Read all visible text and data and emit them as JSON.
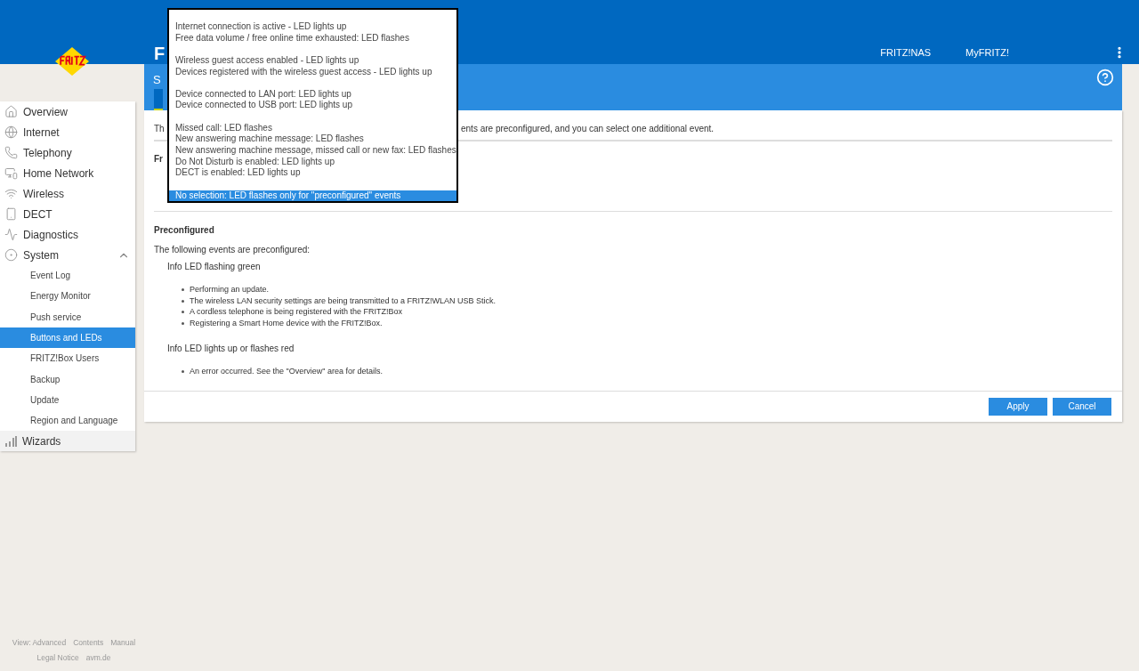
{
  "header": {
    "title_start": "F",
    "links": [
      "FRITZ!NAS",
      "MyFRITZ!"
    ]
  },
  "subheader": {
    "title_start": "S"
  },
  "sidebar": {
    "items": [
      {
        "label": "Overview",
        "selected": false
      },
      {
        "label": "Internet",
        "selected": false
      },
      {
        "label": "Telephony",
        "selected": false
      },
      {
        "label": "Home Network",
        "selected": false
      },
      {
        "label": "Wireless",
        "selected": false
      },
      {
        "label": "DECT",
        "selected": false
      },
      {
        "label": "Diagnostics",
        "selected": false
      },
      {
        "label": "System",
        "selected": false,
        "expanded": true,
        "children": [
          {
            "label": "Event Log",
            "selected": false
          },
          {
            "label": "Energy Monitor",
            "selected": false
          },
          {
            "label": "Push service",
            "selected": false
          },
          {
            "label": "Buttons and LEDs",
            "selected": true
          },
          {
            "label": "FRITZ!Box Users",
            "selected": false
          },
          {
            "label": "Backup",
            "selected": false
          },
          {
            "label": "Update",
            "selected": false
          },
          {
            "label": "Region and Language",
            "selected": false
          }
        ]
      },
      {
        "label": "Wizards",
        "selected": false
      }
    ]
  },
  "content": {
    "intro_start": "Th",
    "intro_end": "ents are preconfigured, and you can select one additional event.",
    "section_start": "Fr",
    "preconfigured": {
      "heading": "Preconfigured",
      "text": "The following events are preconfigured:",
      "groups": [
        {
          "title": "Info LED flashing green",
          "items": [
            "Performing an update.",
            "The wireless LAN security settings are being transmitted to a FRITZ!WLAN USB Stick.",
            "A cordless telephone is being registered with the FRITZ!Box",
            "Registering a Smart Home device with the FRITZ!Box."
          ]
        },
        {
          "title": "Info LED lights up or flashes red",
          "items": [
            "An error occurred. See the \"Overview\" area for details."
          ]
        }
      ]
    },
    "buttons": [
      "Apply",
      "Cancel"
    ]
  },
  "dropdown": {
    "groups": [
      {
        "options": [
          {
            "label": "Internet connection is active - LED lights up",
            "selected": false
          },
          {
            "label": "Free data volume / free online time exhausted: LED flashes",
            "selected": false
          }
        ]
      },
      {
        "options": [
          {
            "label": "Wireless guest access enabled - LED lights up",
            "selected": false
          },
          {
            "label": "Devices registered with the wireless guest access - LED lights up",
            "selected": false
          }
        ]
      },
      {
        "options": [
          {
            "label": "Device connected to LAN port: LED lights up",
            "selected": false
          },
          {
            "label": "Device connected to USB port: LED lights up",
            "selected": false
          }
        ]
      },
      {
        "options": [
          {
            "label": "Missed call: LED flashes",
            "selected": false
          },
          {
            "label": "New answering machine message: LED flashes",
            "selected": false
          },
          {
            "label": "New answering machine message, missed call or new fax: LED flashes",
            "selected": false
          },
          {
            "label": "Do Not Disturb is enabled: LED lights up",
            "selected": false
          },
          {
            "label": "DECT is enabled: LED lights up",
            "selected": false
          }
        ]
      },
      {
        "options": [
          {
            "label": "No selection: LED flashes only for \"preconfigured\" events",
            "selected": true
          }
        ]
      }
    ]
  },
  "footer": {
    "links": [
      "View: Advanced",
      "Contents",
      "Manual"
    ],
    "links_2": [
      "Legal Notice",
      "avm.de"
    ]
  }
}
